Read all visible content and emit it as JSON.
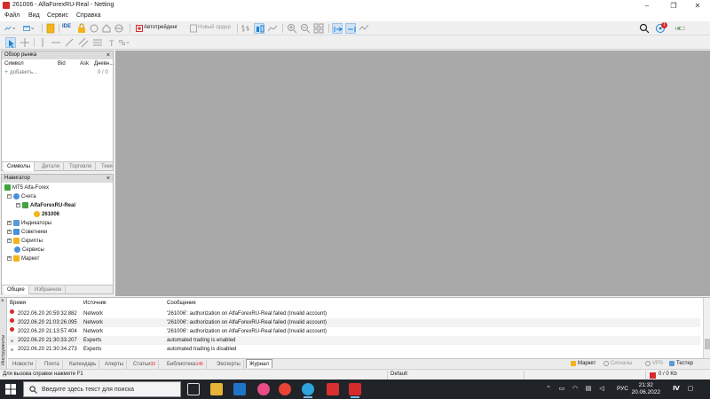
{
  "window": {
    "title": "261006 - AlfaForexRU-Real - Netting",
    "minimize": "–",
    "maximize": "❐",
    "close": "✕"
  },
  "menu": [
    "Файл",
    "Вид",
    "Сервис",
    "Справка"
  ],
  "toolbar": {
    "ide_label": "IDE",
    "autotrading_label": "Автотрейдинг",
    "new_order_label": "Новый ордер",
    "notification_count": "1",
    "accent": "#1a7fd4",
    "danger": "#d62b2b"
  },
  "market_watch": {
    "title": "Обзор рынка",
    "columns": {
      "symbol": "Символ",
      "bid": "Bid",
      "ask": "Ask",
      "change": "Дневн..."
    },
    "add_label": "добавить...",
    "count": "0 / 0",
    "tabs": [
      "Символы",
      "Детали",
      "Торговля",
      "Тики"
    ]
  },
  "navigator": {
    "title": "Навигатор",
    "root": "MT5 Alfa-Forex",
    "accounts": "Счета",
    "server": "AlfaForexRU-Real",
    "account": "261006",
    "indicators": "Индикаторы",
    "experts": "Советники",
    "scripts": "Скрипты",
    "services": "Сервисы",
    "market": "Маркет",
    "tabs": [
      "Общие",
      "Избранное"
    ]
  },
  "journal": {
    "side_label": "Инструменты",
    "headers": {
      "time": "Время",
      "source": "Источник",
      "message": "Сообщение"
    },
    "rows": [
      {
        "time": "2022.06.20 20:59:32.882",
        "source": "Network",
        "message": "'261006': authorization on AlfaForexRU-Real failed (Invalid account)",
        "level": "error"
      },
      {
        "time": "2022.06.20 21:03:26.095",
        "source": "Network",
        "message": "'261006': authorization on AlfaForexRU-Real failed (Invalid account)",
        "level": "error"
      },
      {
        "time": "2022.06.20 21:13:57.404",
        "source": "Network",
        "message": "'261006': authorization on AlfaForexRU-Real failed (Invalid account)",
        "level": "error"
      },
      {
        "time": "2022.06.20 21:30:33.207",
        "source": "Experts",
        "message": "automated trading is enabled",
        "level": "info"
      },
      {
        "time": "2022.06.20 21:30:34.273",
        "source": "Experts",
        "message": "automated trading is disabled",
        "level": "info"
      }
    ],
    "tabs": [
      {
        "label": "Новости",
        "badge": ""
      },
      {
        "label": "Почта",
        "badge": ""
      },
      {
        "label": "Календарь",
        "badge": ""
      },
      {
        "label": "Алерты",
        "badge": ""
      },
      {
        "label": "Статьи",
        "badge": "33"
      },
      {
        "label": "Библиотека",
        "badge": "145"
      },
      {
        "label": "Эксперты",
        "badge": ""
      },
      {
        "label": "Журнал",
        "badge": ""
      }
    ],
    "right_links": {
      "market": "Маркет",
      "signals": "Сигналы",
      "vps": "VPS",
      "tester": "Тестер"
    }
  },
  "statusbar": {
    "help": "Для вызова справки нажмите F1",
    "profile": "Default",
    "traffic": "0 / 0 Kb"
  },
  "taskbar": {
    "search_placeholder": "Введите здесь текст для поиска",
    "lang": "РУС",
    "time": "21:32",
    "date": "20.06.2022"
  }
}
